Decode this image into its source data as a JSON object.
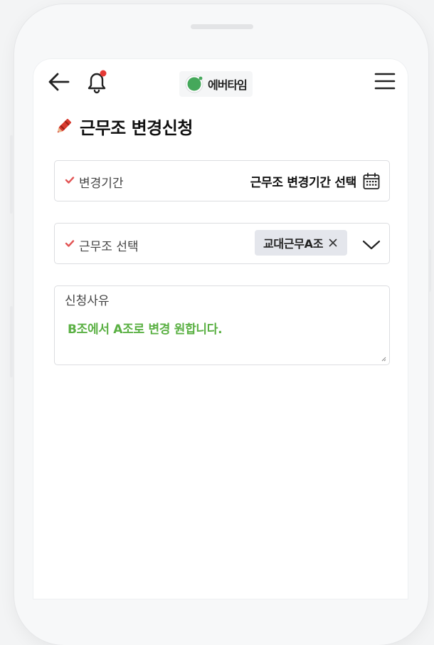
{
  "header": {
    "logo_text": "에버타임"
  },
  "page": {
    "title": "근무조 변경신청"
  },
  "form": {
    "period": {
      "label": "변경기간",
      "value": "근무조 변경기간 선택"
    },
    "shift": {
      "label": "근무조 선택",
      "chip_label": "교대근무A조"
    },
    "reason": {
      "label": "신청사유",
      "value": "B조에서 A조로 변경 원합니다."
    }
  },
  "colors": {
    "accent_green": "#5ab043",
    "check_red": "#e25555",
    "notification_dot": "#e53935"
  },
  "icons": [
    "back-arrow-icon",
    "bell-icon",
    "menu-icon",
    "crayon-icon",
    "check-icon",
    "calendar-icon",
    "close-icon",
    "chevron-down-icon"
  ]
}
